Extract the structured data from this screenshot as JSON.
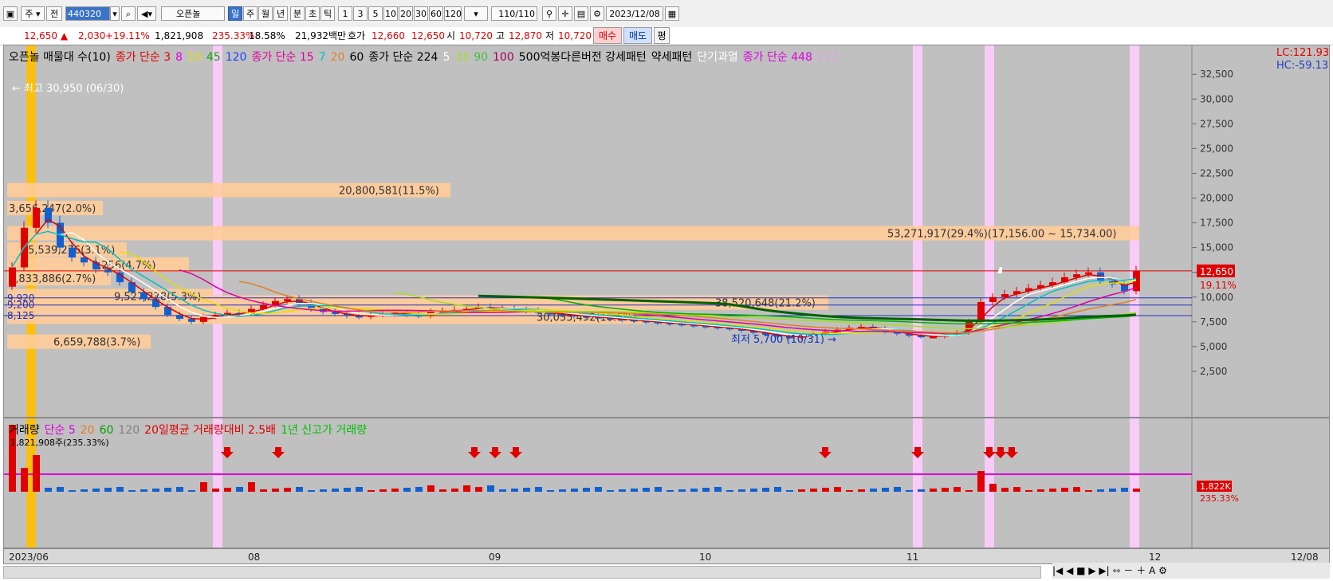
{
  "toolbar": {
    "market": "주",
    "scope": "전",
    "code": "440320",
    "name": "오픈놀",
    "periods": [
      "일",
      "주",
      "월",
      "년",
      "분",
      "초",
      "틱"
    ],
    "active_period": "일",
    "minutes": [
      "1",
      "3",
      "5",
      "10",
      "20",
      "30",
      "60",
      "120"
    ],
    "count": "110",
    "count_total": "/110",
    "date": "2023/12/08"
  },
  "quote": {
    "price": "12,650",
    "change": "2,030",
    "change_pct": "+19.11%",
    "volume": "1,821,908",
    "volume_ratio": "235.33%",
    "turnover": "18.58%",
    "amount": "21,932백만",
    "ask_label": "호가",
    "ask": "12,660",
    "bid": "12,650",
    "open_label": "시",
    "open": "10,720",
    "high_label": "고",
    "high": "12,870",
    "low_label": "저",
    "low": "10,720",
    "buy": "매수",
    "sell": "매도",
    "eval": "평"
  },
  "price_legend": [
    {
      "text": "오픈놀 매물대 수(10)",
      "color": "#000000"
    },
    {
      "text": "종가 단순 3",
      "color": "#e00000"
    },
    {
      "text": "8",
      "color": "#e000e0"
    },
    {
      "text": "10",
      "color": "#e0e000"
    },
    {
      "text": "45",
      "color": "#00b000"
    },
    {
      "text": "120",
      "color": "#2040ff"
    },
    {
      "text": "종가 단순 15",
      "color": "#e000a0"
    },
    {
      "text": "7",
      "color": "#00c0c0"
    },
    {
      "text": "20",
      "color": "#e08020"
    },
    {
      "text": "60",
      "color": "#000000"
    },
    {
      "text": "종가 단순 224",
      "color": "#000000"
    },
    {
      "text": "5",
      "color": "#ffffff"
    },
    {
      "text": "33",
      "color": "#a0e020"
    },
    {
      "text": "90",
      "color": "#40c040"
    },
    {
      "text": "100",
      "color": "#a00060"
    },
    {
      "text": "500억봉다른버전 강세패턴",
      "color": "#000000"
    },
    {
      "text": "약세패턴",
      "color": "#000000"
    },
    {
      "text": "단기과열",
      "color": "#ffffff"
    },
    {
      "text": "종가 단순 448",
      "color": "#e000e0"
    },
    {
      "text": "112",
      "color": "#e0a0e0"
    }
  ],
  "right_labels": {
    "lc": "LC:121.93",
    "hc": "HC:-59.13"
  },
  "y_ticks": [
    "32,500",
    "30,000",
    "27,500",
    "25,000",
    "22,500",
    "20,000",
    "17,500",
    "15,000",
    "12,500",
    "10,000",
    "7,500",
    "5,000",
    "2,500"
  ],
  "price_tag": {
    "price": "12,650",
    "pct": "19.11%"
  },
  "price_levels": [
    "9,920",
    "9,200",
    "8,125"
  ],
  "annotations": {
    "high": "최고 30,950 (06/30)",
    "low": "최저 5,700 (10/31)"
  },
  "volume_profile": [
    {
      "label": "20,800,581(11.5%)"
    },
    {
      "label": "53,271,917(29.4%)(17,156.00 ~ 15,734.00)"
    },
    {
      "label": "3,656,247(2.0%)"
    },
    {
      "label": "5,539,276(3.1%)"
    },
    {
      "label": "8,256(4.7%)"
    },
    {
      "label": "4,833,886(2.7%)"
    },
    {
      "label": "9,527,278(5.3%)"
    },
    {
      "label": "38,520,648(21.2%)"
    },
    {
      "label": "30,055,492(16.6%)"
    },
    {
      "label": "6,659,788(3.7%)"
    }
  ],
  "volume_legend": [
    {
      "text": "거래량",
      "color": "#000000"
    },
    {
      "text": "단순 5",
      "color": "#e000e0"
    },
    {
      "text": "20",
      "color": "#e08020"
    },
    {
      "text": "60",
      "color": "#00a000"
    },
    {
      "text": "120",
      "color": "#808080"
    },
    {
      "text": "20일평균 거래량대비 2.5배",
      "color": "#e00000"
    },
    {
      "text": "1년 신고가 거래량",
      "color": "#00c000"
    }
  ],
  "volume_info": "1,821,908주(235.33%)",
  "volume_tag": {
    "value": "1,822K",
    "pct": "235.33%"
  },
  "x_ticks": [
    "2023/06",
    "08",
    "09",
    "10",
    "11",
    "12",
    "12/08"
  ],
  "colors": {
    "up": "#e00000",
    "down": "#1060d0",
    "pane": "#c0c0c0",
    "profile": "#ffcc99",
    "highlight": "#ffccff",
    "marker": "#ffc000"
  },
  "chart_data": {
    "type": "candlestick",
    "ylim": [
      0,
      33000
    ],
    "x_labels": [
      "2023/06",
      "08",
      "09",
      "10",
      "11",
      "12",
      "12/08"
    ],
    "candles_close_approx": [
      13000,
      17000,
      19000,
      17500,
      15000,
      14000,
      13500,
      12800,
      12500,
      11500,
      10500,
      9800,
      9000,
      8200,
      7800,
      7500,
      8000,
      8200,
      8400,
      8300,
      8800,
      9200,
      9600,
      9800,
      9400,
      8800,
      8500,
      8300,
      8100,
      8000,
      8200,
      8300,
      8400,
      8200,
      8100,
      8500,
      8600,
      8700,
      8800,
      9000,
      8900,
      8800,
      8700,
      8600,
      8400,
      8300,
      8200,
      8100,
      8000,
      7900,
      7800,
      7700,
      7600,
      7500,
      7400,
      7300,
      7200,
      7100,
      7000,
      6900,
      6800,
      6600,
      6400,
      6200,
      6000,
      5900,
      6100,
      6300,
      6500,
      6700,
      6900,
      7000,
      6800,
      6500,
      6300,
      6100,
      6000,
      6000,
      6200,
      6400,
      7500,
      9500,
      10000,
      10300,
      10600,
      10900,
      11200,
      11500,
      12000,
      12300,
      12500,
      11600,
      11300,
      10600,
      12650
    ],
    "volume_series": "daily volume bars, latest 1,821,908"
  }
}
